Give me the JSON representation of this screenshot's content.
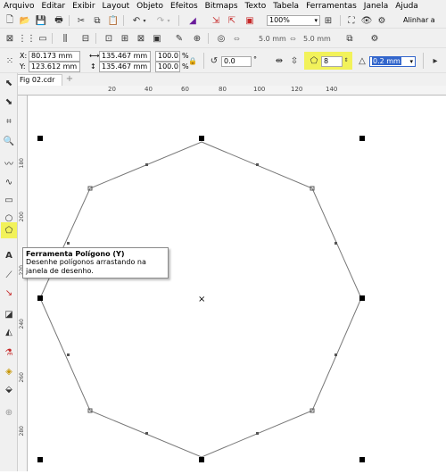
{
  "menu": [
    "Arquivo",
    "Editar",
    "Exibir",
    "Layout",
    "Objeto",
    "Efeitos",
    "Bitmaps",
    "Texto",
    "Tabela",
    "Ferramentas",
    "Janela",
    "Ajuda"
  ],
  "toolbar": {
    "zoom": "100%",
    "align_label": "Alinhar a",
    "nudge1": "5.0 mm",
    "nudge2": "5.0 mm"
  },
  "propbar": {
    "x_label": "X:",
    "x_value": "80.173 mm",
    "y_label": "Y:",
    "y_value": "123.612 mm",
    "w_value": "135.467 mm",
    "h_value": "135.467 mm",
    "sx_value": "100.0",
    "sy_value": "100.0",
    "percent": "%",
    "rotation_value": "0.0",
    "degree": "°",
    "sides_value": "8",
    "outline_value": "0.2 mm"
  },
  "document_tab": "Fig 02.cdr",
  "ruler_top_ticks": [
    "20",
    "40",
    "60",
    "80",
    "100",
    "120",
    "140"
  ],
  "ruler_left_ticks": [
    "180",
    "200",
    "220",
    "240",
    "260",
    "280"
  ],
  "tooltip": {
    "title": "Ferramenta Polígono (Y)",
    "desc": "Desenhe polígonos arrastando na janela de desenho."
  },
  "colors": {
    "highlight": "#f2f25a",
    "outline_sel": "#3366cc"
  }
}
